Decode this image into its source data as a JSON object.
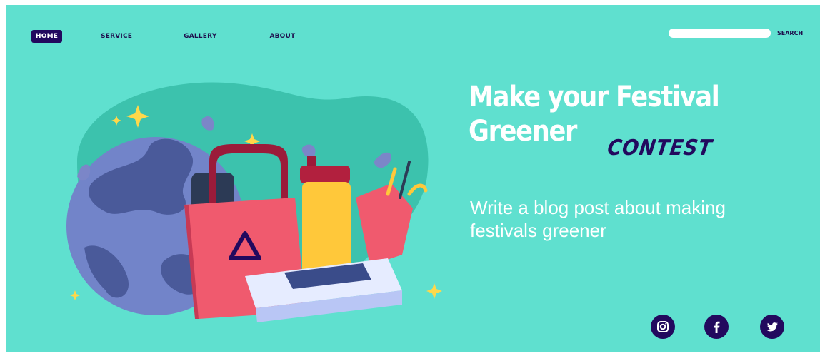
{
  "nav": {
    "items": [
      {
        "label": "HOME",
        "active": true
      },
      {
        "label": "SERVICE"
      },
      {
        "label": "GALLERY"
      },
      {
        "label": "ABOUT"
      }
    ]
  },
  "search": {
    "label": "SEARCH",
    "value": "",
    "placeholder": ""
  },
  "hero": {
    "headline_line1": "Make your Festival",
    "headline_line2": "Greener",
    "accent_word": "CONTEST",
    "subtitle": "Write a blog post about making festivals greener"
  },
  "social": {
    "icons": [
      "instagram-icon",
      "facebook-icon",
      "twitter-icon"
    ]
  },
  "colors": {
    "background": "#5fe0cf",
    "accent_dark": "#22095e",
    "text_light": "#ffffff",
    "bag": "#f05a6e",
    "bottle": "#ffc83a",
    "earth": "#6e80c8"
  }
}
